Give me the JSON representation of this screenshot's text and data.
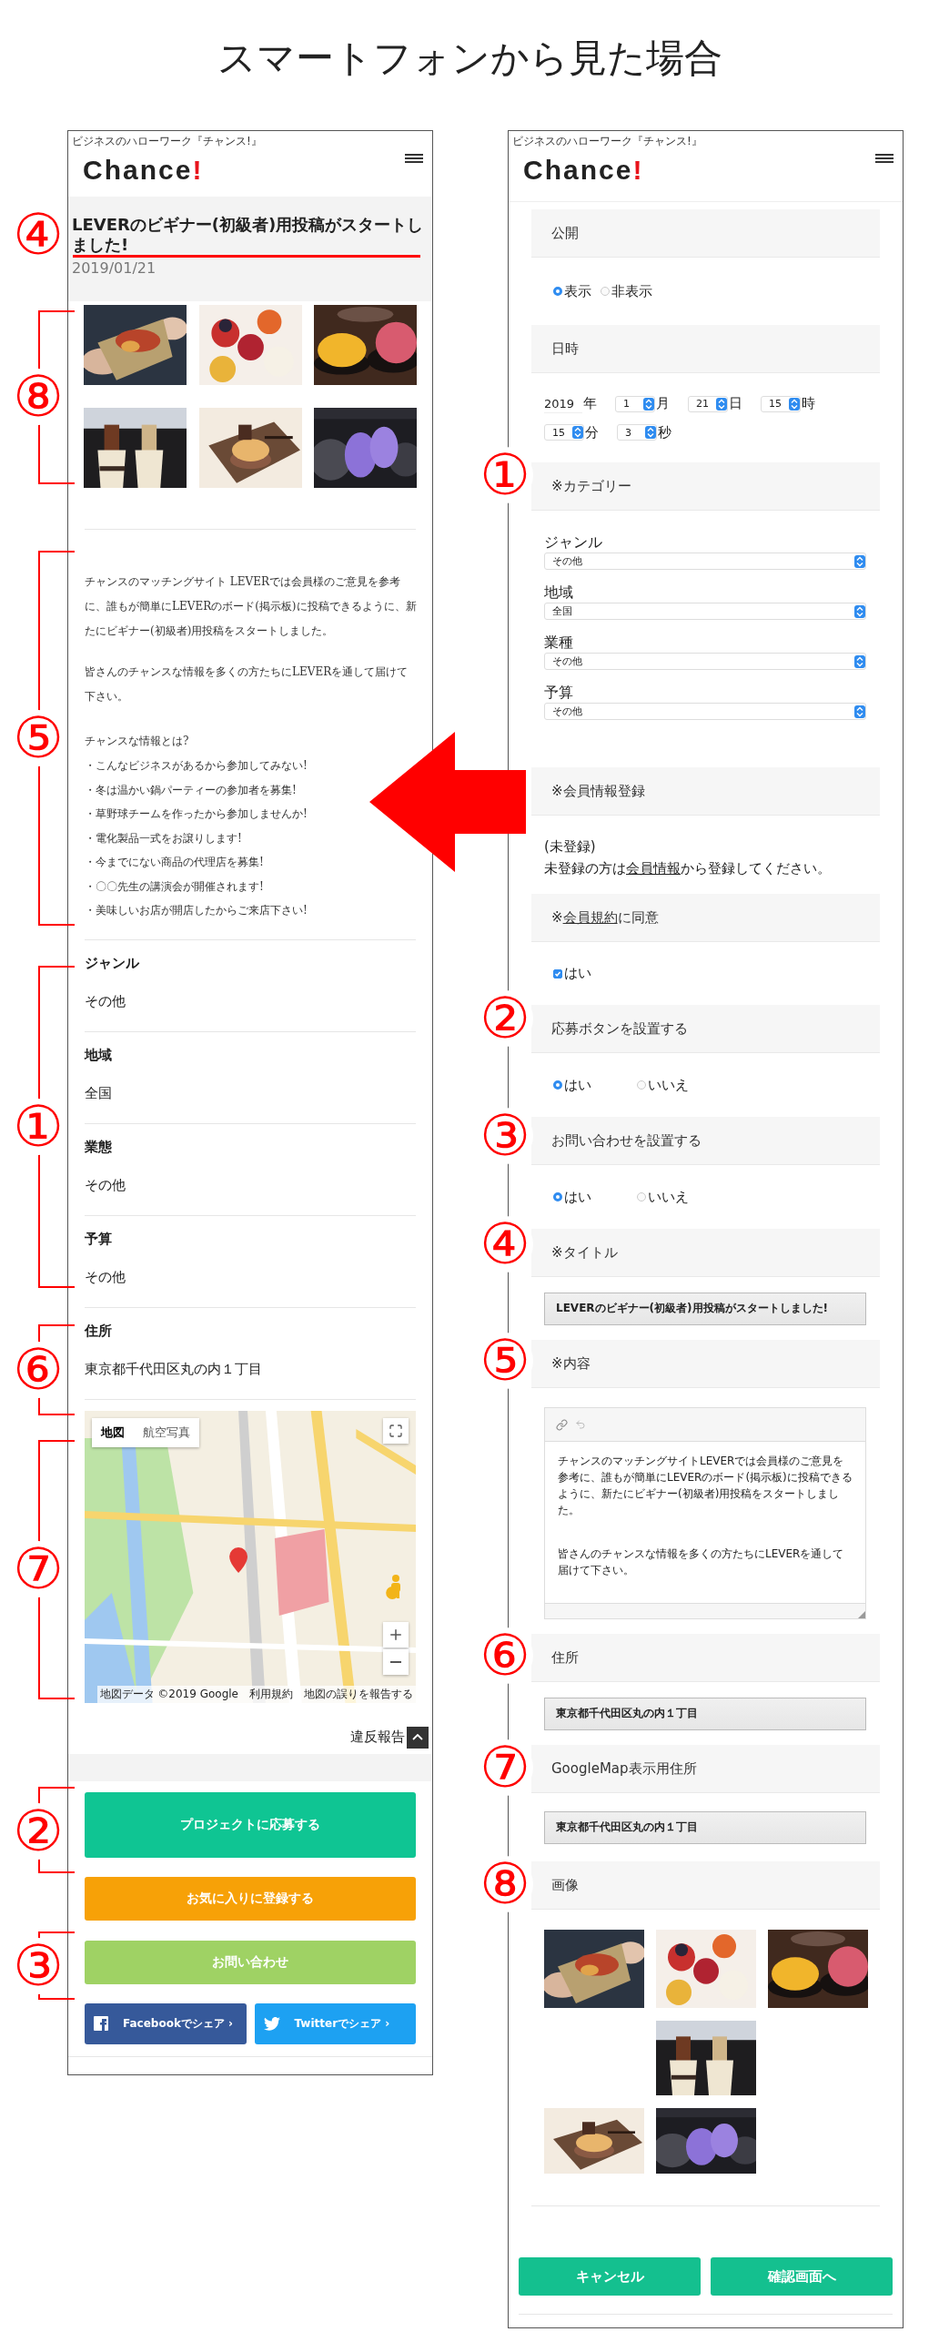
{
  "heading": "スマートフォンから見た場合",
  "view_phone": {
    "site_tagline": "ビジネスのハローワーク『チャンス!』",
    "logo": {
      "text": "Chance",
      "mark": "!"
    },
    "post_title": "LEVERのビギナー(初級者)用投稿がスタートしました!",
    "post_date": "2019/01/21",
    "body": {
      "paragraphs": [
        "チャンスのマッチングサイト LEVERでは会員様のご意見を参考に、誰もが簡単にLEVERのボード(掲示板)に投稿できるように、新たにビギナー(初級者)用投稿をスタートしました。",
        "皆さんのチャンスな情報を多くの方たちにLEVERを通して届けて下さい。"
      ],
      "list_title": "チャンスな情報とは?",
      "list_items": [
        "・こんなビジネスがあるから参加してみない!",
        "・冬は温かい鍋パーティーの参加者を募集!",
        "・草野球チームを作ったから参加しませんか!",
        "・電化製品一式をお譲りします!",
        "・今までにない商品の代理店を募集!",
        "・〇〇先生の講演会が開催されます!",
        "・美味しいお店が開店したからご来店下さい!"
      ]
    },
    "details": [
      {
        "label": "ジャンル",
        "value": "その他"
      },
      {
        "label": "地域",
        "value": "全国"
      },
      {
        "label": "業態",
        "value": "その他"
      },
      {
        "label": "予算",
        "value": "その他"
      },
      {
        "label": "住所",
        "value": "東京都千代田区丸の内１丁目"
      }
    ],
    "map": {
      "tabs": [
        {
          "label": "地図",
          "selected": true
        },
        {
          "label": "航空写真",
          "selected": false
        }
      ],
      "attribution": "地図データ ©2019 Google　利用規約　地図の誤りを報告する"
    },
    "report_link": "違反報告",
    "buttons": [
      {
        "label": "プロジェクトに応募する",
        "kind": "apply"
      },
      {
        "label": "お気に入りに登録する",
        "kind": "favorite"
      },
      {
        "label": "お問い合わせ",
        "kind": "contact"
      }
    ],
    "share": [
      {
        "label": "Facebookでシェア ›",
        "kind": "facebook"
      },
      {
        "label": "Twitterでシェア ›",
        "kind": "twitter"
      }
    ],
    "annotations": [
      {
        "number": "④",
        "kind": "underline"
      },
      {
        "number": "⑧",
        "kind": "bracket"
      },
      {
        "number": "⑤",
        "kind": "bracket"
      },
      {
        "number": "①",
        "kind": "bracket"
      },
      {
        "number": "⑥",
        "kind": "bracket"
      },
      {
        "number": "⑦",
        "kind": "bracket"
      },
      {
        "number": "②",
        "kind": "bracket"
      },
      {
        "number": "③",
        "kind": "bracket"
      }
    ]
  },
  "edit_phone": {
    "site_tagline": "ビジネスのハローワーク『チャンス!』",
    "logo": {
      "text": "Chance",
      "mark": "!"
    },
    "sections": [
      {
        "kind": "radio",
        "header": "公開",
        "options": [
          {
            "label": "表示",
            "selected": true
          },
          {
            "label": "非表示",
            "selected": false
          }
        ]
      },
      {
        "kind": "datetime",
        "header": "日時",
        "parts": [
          {
            "kind": "text",
            "value": "2019",
            "unit": "年"
          },
          {
            "kind": "select",
            "value": "1",
            "unit": "月"
          },
          {
            "kind": "select",
            "value": "21",
            "unit": "日"
          },
          {
            "kind": "select",
            "value": "15",
            "unit": "時"
          },
          {
            "kind": "select",
            "value": "15",
            "unit": "分"
          },
          {
            "kind": "select",
            "value": "3",
            "unit": "秒"
          }
        ]
      },
      {
        "kind": "selects",
        "header": "※カテゴリー",
        "fields": [
          {
            "label": "ジャンル",
            "value": "その他"
          },
          {
            "label": "地域",
            "value": "全国"
          },
          {
            "label": "業種",
            "value": "その他"
          },
          {
            "label": "予算",
            "value": "その他"
          }
        ]
      },
      {
        "kind": "notice",
        "header": "※会員情報登録",
        "status": "(未登録)",
        "message": {
          "before": "未登録の方は",
          "link": "会員情報",
          "after": "から登録してください。"
        }
      },
      {
        "kind": "checkbox",
        "header_parts": [
          {
            "text": "※",
            "link": false
          },
          {
            "text": "会員規約",
            "link": true
          },
          {
            "text": "に同意",
            "link": false
          }
        ],
        "option": {
          "label": "はい",
          "checked": true
        }
      },
      {
        "kind": "radio",
        "header": "応募ボタンを設置する",
        "options": [
          {
            "label": "はい",
            "selected": true
          },
          {
            "label": "いいえ",
            "selected": false
          }
        ]
      },
      {
        "kind": "radio",
        "header": "お問い合わせを設置する",
        "options": [
          {
            "label": "はい",
            "selected": true
          },
          {
            "label": "いいえ",
            "selected": false
          }
        ]
      },
      {
        "kind": "text",
        "header": "※タイトル",
        "value": "LEVERのビギナー(初級者)用投稿がスタートしました!"
      },
      {
        "kind": "editor",
        "header": "※内容",
        "paragraphs": [
          "チャンスのマッチングサイトLEVERでは会員様のご意見を参考に、誰もが簡単にLEVERのボード(掲示板)に投稿できるように、新たにビギナー(初級者)用投稿をスタートしました。",
          "皆さんのチャンスな情報を多くの方たちにLEVERを通して届けて下さい。"
        ]
      },
      {
        "kind": "text",
        "header": "住所",
        "value": "東京都千代田区丸の内１丁目"
      },
      {
        "kind": "text",
        "header": "GoogleMap表示用住所",
        "value": "東京都千代田区丸の内１丁目"
      },
      {
        "kind": "images",
        "header": "画像"
      }
    ],
    "buttons": [
      {
        "label": "キャンセル"
      },
      {
        "label": "確認画面へ"
      }
    ],
    "annotations": [
      {
        "number": "①",
        "kind": "circle"
      },
      {
        "number": "②",
        "kind": "circle"
      },
      {
        "number": "③",
        "kind": "circle"
      },
      {
        "number": "④",
        "kind": "circle"
      },
      {
        "number": "⑤",
        "kind": "circle"
      },
      {
        "number": "⑥",
        "kind": "circle"
      },
      {
        "number": "⑦",
        "kind": "circle"
      },
      {
        "number": "⑧",
        "kind": "circle"
      }
    ]
  }
}
